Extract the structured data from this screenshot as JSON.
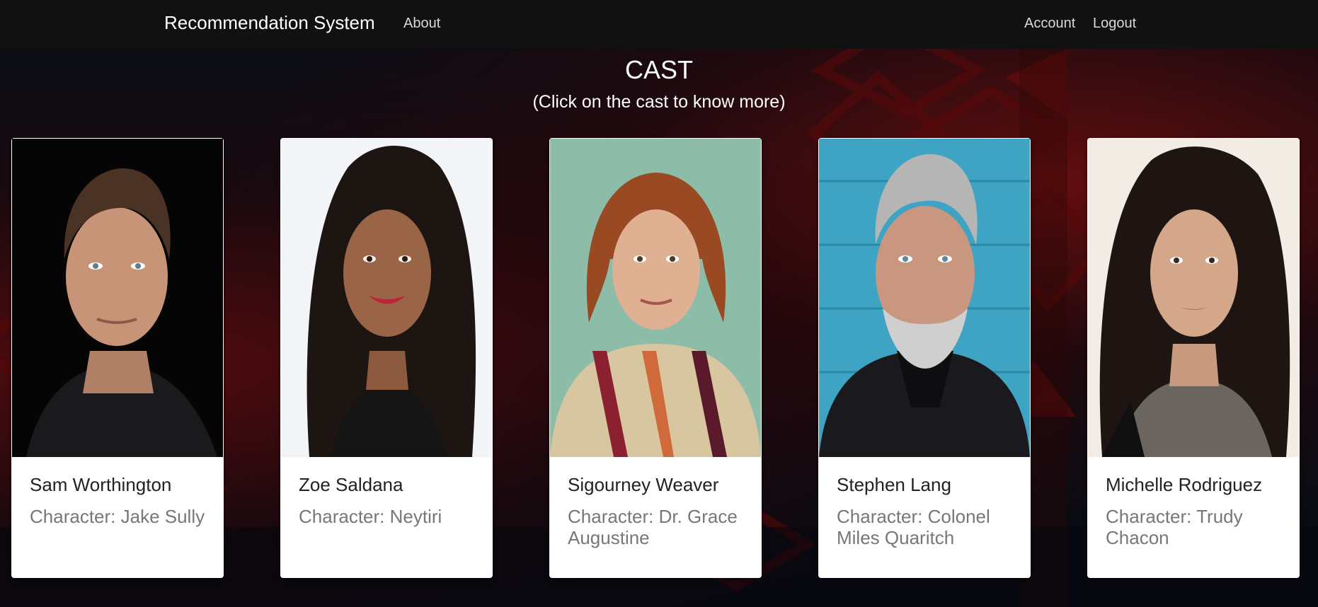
{
  "navbar": {
    "brand": "Recommendation System",
    "about": "About",
    "account": "Account",
    "logout": "Logout"
  },
  "section": {
    "title": "CAST",
    "subtitle": "(Click on the cast to know more)"
  },
  "cast": [
    {
      "name": "Sam Worthington",
      "character": "Character: Jake Sully"
    },
    {
      "name": "Zoe Saldana",
      "character": "Character: Neytiri"
    },
    {
      "name": "Sigourney Weaver",
      "character": "Character: Dr. Grace Augustine"
    },
    {
      "name": "Stephen Lang",
      "character": "Character: Colonel Miles Quaritch"
    },
    {
      "name": "Michelle Rodriguez",
      "character": "Character: Trudy Chacon"
    }
  ],
  "colors": {
    "navbar": "#111111",
    "background_accent": "#8c0a0a",
    "card": "#ffffff",
    "name_text": "#222222",
    "character_text": "#777777"
  }
}
